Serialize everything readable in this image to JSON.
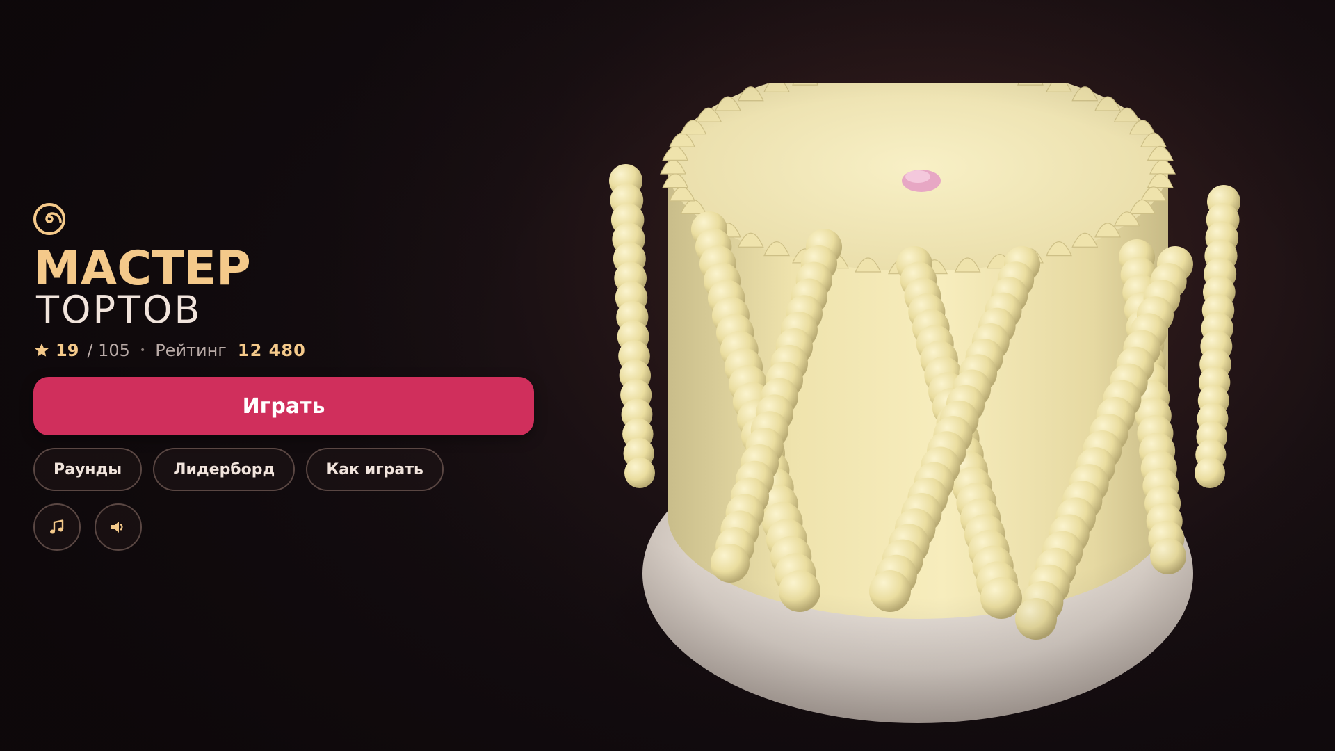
{
  "game": {
    "title_main": "МАСТЕР",
    "title_sub": "ТОРТОВ",
    "logo_icon": "spiral-logo-icon"
  },
  "stats": {
    "star_icon": "star-icon",
    "stars_collected": "19",
    "stars_total": "/ 105",
    "separator": "•",
    "rating_label": "Рейтинг",
    "rating_value": "12 480"
  },
  "actions": {
    "play_label": "Играть",
    "rounds_label": "Раунды",
    "leaderboard_label": "Лидерборд",
    "how_to_play_label": "Как играть"
  },
  "toggles": {
    "music_icon": "music-note-icon",
    "sound_icon": "speaker-icon"
  },
  "colors": {
    "accent_gold": "#f4c98a",
    "play_button": "#d02f5c",
    "background": "#140d10",
    "cake_cream": "#f3e8b8"
  }
}
